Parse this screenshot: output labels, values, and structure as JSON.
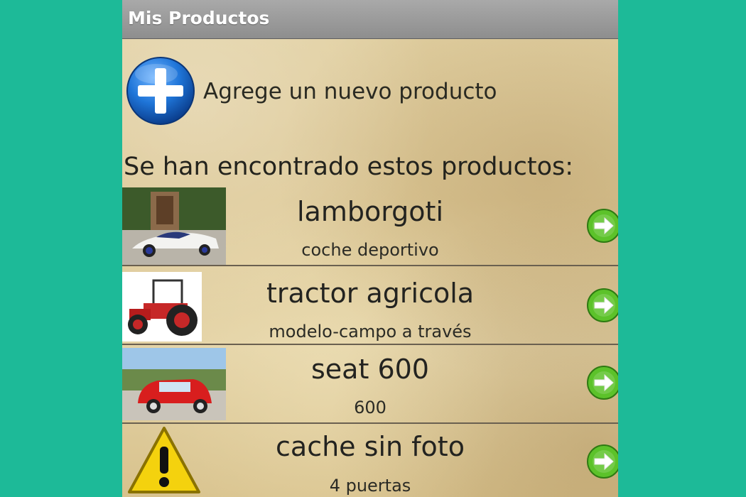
{
  "app": {
    "title": "Mis Productos"
  },
  "add": {
    "label": "Agrege un nuevo producto"
  },
  "list": {
    "heading": "Se han encontrado estos productos:",
    "items": [
      {
        "name": "lamborgoti",
        "description": "coche deportivo",
        "image_icon": "sports-car-photo"
      },
      {
        "name": "tractor agricola",
        "description": "modelo-campo a través",
        "image_icon": "tractor-photo"
      },
      {
        "name": "seat 600",
        "description": "600",
        "image_icon": "red-seat-car-photo"
      },
      {
        "name": "cache sin foto",
        "description": "4 puertas",
        "image_icon": "warning-icon"
      }
    ]
  },
  "colors": {
    "background": "#1dba98",
    "titlebar": "#9b9b9b",
    "accent_green": "#5cc22a",
    "add_blue": "#1f75d8"
  }
}
